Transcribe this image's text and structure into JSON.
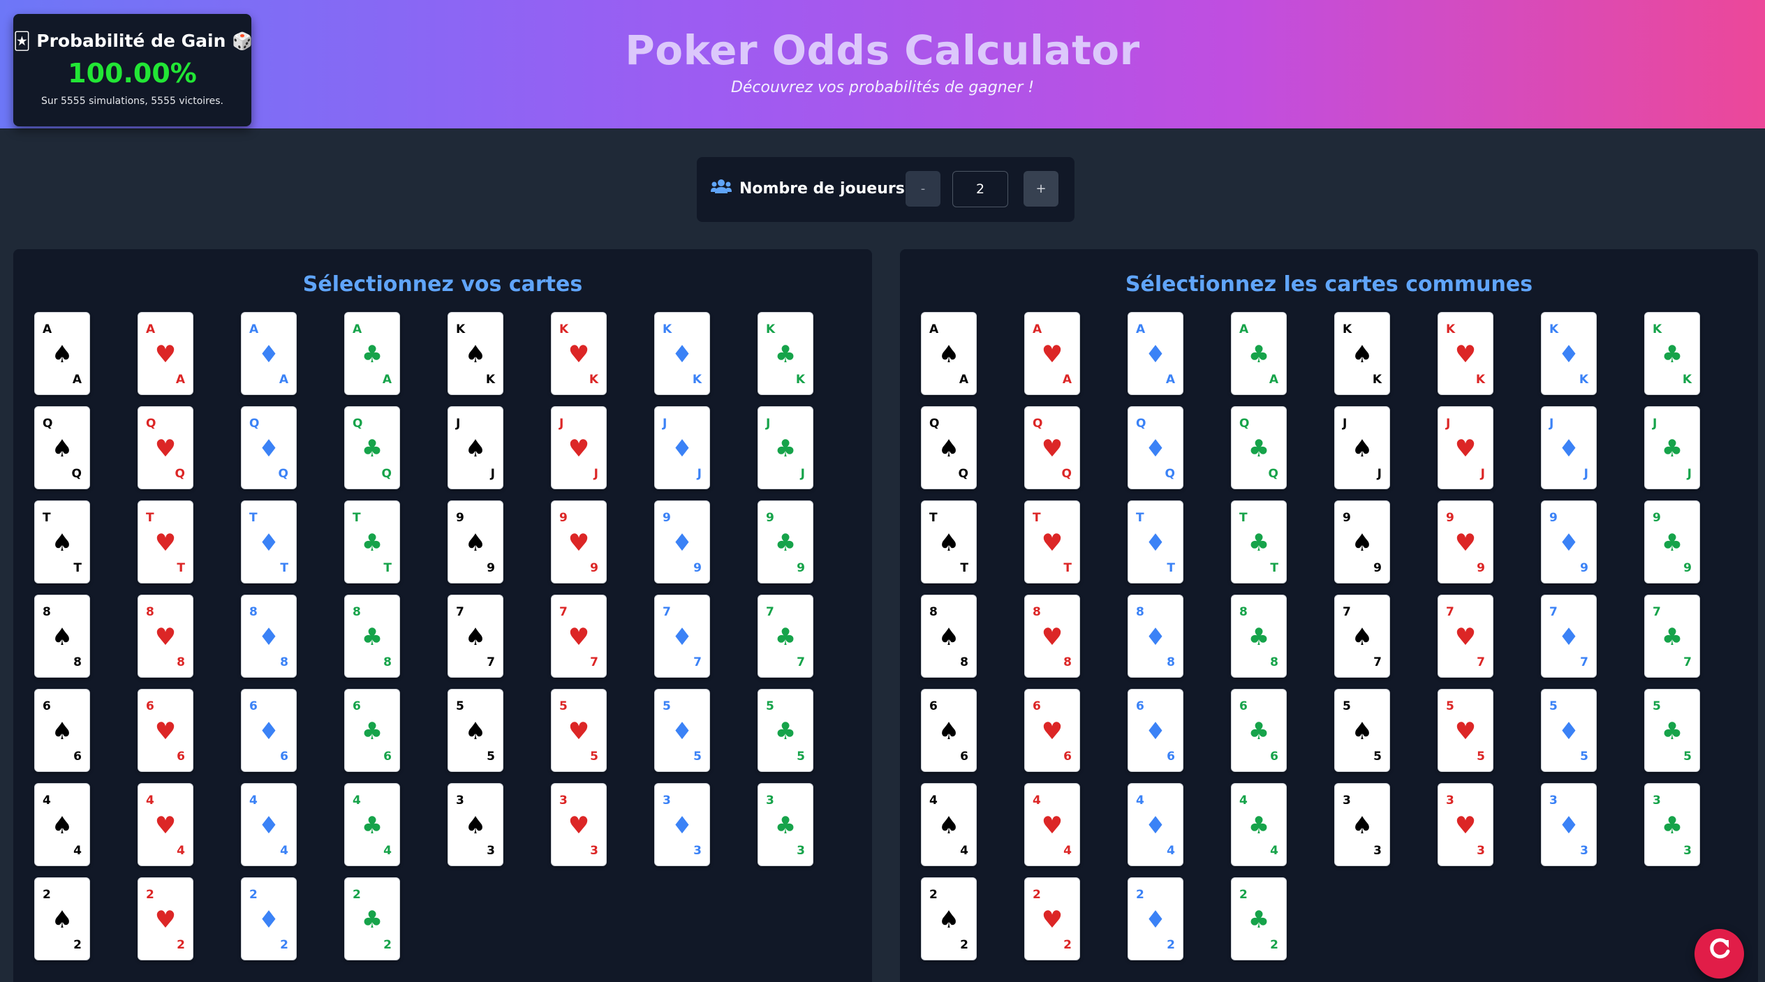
{
  "header": {
    "title": "Poker Odds Calculator",
    "subtitle": "Découvrez vos probabilités de gagner !"
  },
  "odds": {
    "title": "Probabilité de Gain",
    "left_icon": "🃏",
    "right_icon": "🎲",
    "value": "100.00%",
    "summary": "Sur 5555 simulations, 5555 victoires."
  },
  "players": {
    "icon": "users-icon",
    "label": "Nombre de joueurs :",
    "minus": "-",
    "plus": "+",
    "value": "2"
  },
  "panels": {
    "hand_title": "Sélectionnez vos cartes",
    "board_title": "Sélectionnez les cartes communes"
  },
  "deck": [
    {
      "rank": "A",
      "suit": "spade"
    },
    {
      "rank": "A",
      "suit": "heart"
    },
    {
      "rank": "A",
      "suit": "diamond"
    },
    {
      "rank": "A",
      "suit": "club"
    },
    {
      "rank": "K",
      "suit": "spade"
    },
    {
      "rank": "K",
      "suit": "heart"
    },
    {
      "rank": "K",
      "suit": "diamond"
    },
    {
      "rank": "K",
      "suit": "club"
    },
    {
      "rank": "Q",
      "suit": "spade"
    },
    {
      "rank": "Q",
      "suit": "heart"
    },
    {
      "rank": "Q",
      "suit": "diamond"
    },
    {
      "rank": "Q",
      "suit": "club"
    },
    {
      "rank": "J",
      "suit": "spade"
    },
    {
      "rank": "J",
      "suit": "heart"
    },
    {
      "rank": "J",
      "suit": "diamond"
    },
    {
      "rank": "J",
      "suit": "club"
    },
    {
      "rank": "T",
      "suit": "spade"
    },
    {
      "rank": "T",
      "suit": "heart"
    },
    {
      "rank": "T",
      "suit": "diamond"
    },
    {
      "rank": "T",
      "suit": "club"
    },
    {
      "rank": "9",
      "suit": "spade"
    },
    {
      "rank": "9",
      "suit": "heart"
    },
    {
      "rank": "9",
      "suit": "diamond"
    },
    {
      "rank": "9",
      "suit": "club"
    },
    {
      "rank": "8",
      "suit": "spade"
    },
    {
      "rank": "8",
      "suit": "heart"
    },
    {
      "rank": "8",
      "suit": "diamond"
    },
    {
      "rank": "8",
      "suit": "club"
    },
    {
      "rank": "7",
      "suit": "spade"
    },
    {
      "rank": "7",
      "suit": "heart"
    },
    {
      "rank": "7",
      "suit": "diamond"
    },
    {
      "rank": "7",
      "suit": "club"
    },
    {
      "rank": "6",
      "suit": "spade"
    },
    {
      "rank": "6",
      "suit": "heart"
    },
    {
      "rank": "6",
      "suit": "diamond"
    },
    {
      "rank": "6",
      "suit": "club"
    },
    {
      "rank": "5",
      "suit": "spade"
    },
    {
      "rank": "5",
      "suit": "heart"
    },
    {
      "rank": "5",
      "suit": "diamond"
    },
    {
      "rank": "5",
      "suit": "club"
    },
    {
      "rank": "4",
      "suit": "spade"
    },
    {
      "rank": "4",
      "suit": "heart"
    },
    {
      "rank": "4",
      "suit": "diamond"
    },
    {
      "rank": "4",
      "suit": "club"
    },
    {
      "rank": "3",
      "suit": "spade"
    },
    {
      "rank": "3",
      "suit": "heart"
    },
    {
      "rank": "3",
      "suit": "diamond"
    },
    {
      "rank": "3",
      "suit": "club"
    },
    {
      "rank": "2",
      "suit": "spade"
    },
    {
      "rank": "2",
      "suit": "heart"
    },
    {
      "rank": "2",
      "suit": "diamond"
    },
    {
      "rank": "2",
      "suit": "club"
    }
  ],
  "suit_symbols": {
    "spade": "♠",
    "heart": "♥",
    "diamond": "♦",
    "club": "♣"
  },
  "colors": {
    "spade": "#000000",
    "heart": "#dc2626",
    "diamond": "#3b82f6",
    "club": "#16a34a",
    "win": "#22e635",
    "accent": "#60a5fa",
    "reset": "#e11d48"
  },
  "reset": {
    "icon": "refresh-icon"
  }
}
